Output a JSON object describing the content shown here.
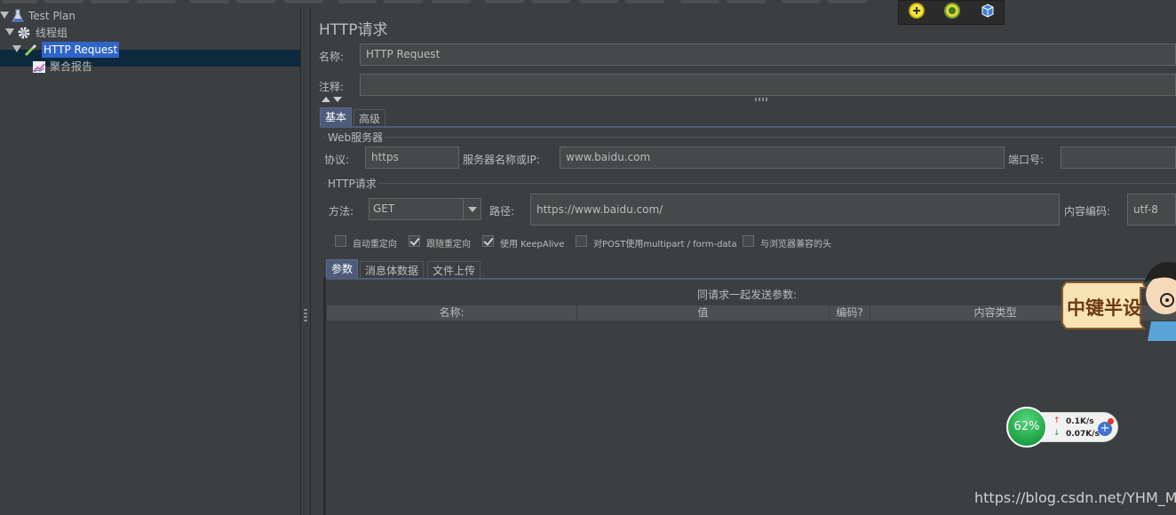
{
  "tree": {
    "items": [
      {
        "label": "Test Plan",
        "icon": "flask-icon"
      },
      {
        "label": "线程组",
        "icon": "gear-icon"
      },
      {
        "label": "HTTP Request",
        "icon": "pipette-icon"
      },
      {
        "label": "聚合报告",
        "icon": "chart-icon"
      }
    ]
  },
  "main": {
    "title": "HTTP请求",
    "name_label": "名称:",
    "name_value": "HTTP Request",
    "comment_label": "注释:",
    "comment_value": "",
    "tabs": [
      "基本",
      "高级"
    ],
    "web_server": {
      "title": "Web服务器",
      "protocol_label": "协议:",
      "protocol_value": "https",
      "server_label": "服务器名称或IP:",
      "server_value": "www.baidu.com",
      "port_label": "端口号:",
      "port_value": ""
    },
    "http_request": {
      "title": "HTTP请求",
      "method_label": "方法:",
      "method_value": "GET",
      "path_label": "路径:",
      "path_value": "https://www.baidu.com/",
      "encoding_label": "内容编码:",
      "encoding_value": "utf-8"
    },
    "checkboxes": [
      {
        "label": "自动重定向",
        "checked": false
      },
      {
        "label": "跟随重定向",
        "checked": true
      },
      {
        "label": "使用 KeepAlive",
        "checked": true
      },
      {
        "label": "对POST使用multipart / form-data",
        "checked": false
      },
      {
        "label": "与浏览器兼容的头",
        "checked": false
      }
    ],
    "param_tabs": [
      "参数",
      "消息体数据",
      "文件上传"
    ],
    "params_caption": "同请求一起发送参数:",
    "table_headers": [
      "名称:",
      "值",
      "编码?",
      "内容类型"
    ]
  },
  "mascot_text": "中键半设",
  "net_widget": {
    "percent": "62%",
    "up": "0.1K/s",
    "down": "0.07K/s",
    "plus": "+"
  },
  "watermark": "https://blog.csdn.net/YHM_MM",
  "colors": {
    "background": "#3c3f41",
    "selection": "#2f65ca",
    "active_tab": "#4e5c7a",
    "field": "#45494a"
  }
}
